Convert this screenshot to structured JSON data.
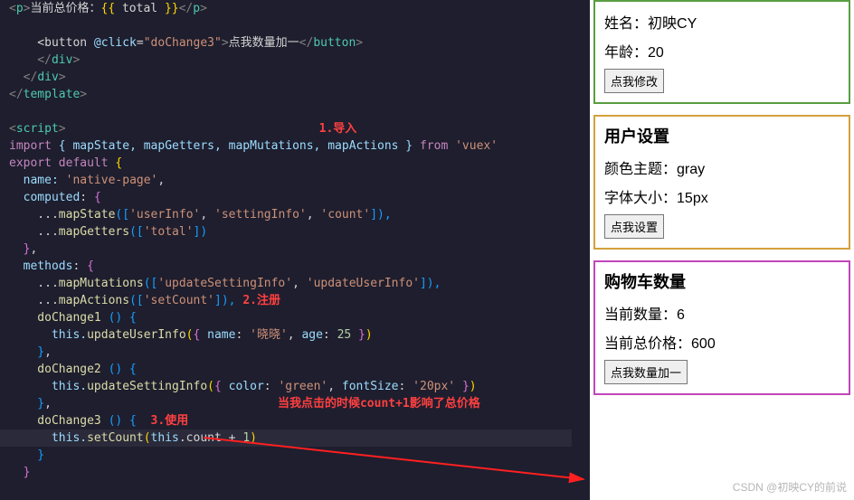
{
  "code": {
    "l1": "    <p>当前总价格：{{ total }}</p>",
    "l2": "",
    "l3a": "    <button ",
    "l3b": "@click",
    "l3c": "=",
    "l3d": "\"doChange3\"",
    "l3e": ">点我数量加一</button>",
    "l4": "    </div>",
    "l5": "  </div>",
    "l6": "</template>",
    "l7": "",
    "l8": "<script>",
    "note1": "1.导入",
    "l9a": "import ",
    "l9b": "{ mapState, mapGetters, mapMutations, mapActions }",
    "l9c": " from ",
    "l9d": "'vuex'",
    "l10a": "export default ",
    "l10b": "{",
    "l11a": "  name: ",
    "l11b": "'native-page'",
    "l11c": ",",
    "l12": "  computed: {",
    "l13a": "    ...",
    "l13b": "mapState",
    "l13c": "([",
    "l13d": "'userInfo'",
    "l13e": ", ",
    "l13f": "'settingInfo'",
    "l13g": ", ",
    "l13h": "'count'",
    "l13i": "]),",
    "l14a": "    ...",
    "l14b": "mapGetters",
    "l14c": "([",
    "l14d": "'total'",
    "l14e": "])",
    "l15": "  },",
    "l16": "  methods: {",
    "l17a": "    ...",
    "l17b": "mapMutations",
    "l17c": "([",
    "l17d": "'updateSettingInfo'",
    "l17e": ", ",
    "l17f": "'updateUserInfo'",
    "l17g": "]),",
    "l18a": "    ...",
    "l18b": "mapActions",
    "l18c": "([",
    "l18d": "'setCount'",
    "l18e": "]),",
    "note2": "2.注册",
    "l19": "    doChange1 () {",
    "l20a": "      this.",
    "l20b": "updateUserInfo",
    "l20c": "({ name: ",
    "l20d": "'晓晓'",
    "l20e": ", age: ",
    "l20f": "25",
    "l20g": " })",
    "l21": "    },",
    "l22": "    doChange2 () {",
    "l23a": "      this.",
    "l23b": "updateSettingInfo",
    "l23c": "({ color: ",
    "l23d": "'green'",
    "l23e": ", fontSize: ",
    "l23f": "'20px'",
    "l23g": " })",
    "l24": "    },",
    "note3text": "当我点击的时候count+1影响了总价格",
    "l25a": "    doChange3 () {  ",
    "note3": "3.使用",
    "l26a": "      this.",
    "l26b": "setCount",
    "l26c": "(this.count + ",
    "l26d": "1",
    "l26e": ")",
    "l27": "    }",
    "l28": "  }"
  },
  "preview": {
    "panel1": {
      "nameLabel": "姓名：",
      "nameVal": "初映CY",
      "ageLabel": "年龄：",
      "ageVal": "20",
      "btn": "点我修改"
    },
    "panel2": {
      "title": "用户设置",
      "themeLabel": "颜色主题：",
      "themeVal": "gray",
      "fontLabel": "字体大小：",
      "fontVal": "15px",
      "btn": "点我设置"
    },
    "panel3": {
      "title": "购物车数量",
      "qtyLabel": "当前数量：",
      "qtyVal": "6",
      "totalLabel": "当前总价格：",
      "totalVal": "600",
      "btn": "点我数量加一"
    }
  },
  "watermark": "CSDN @初映CY的前说"
}
